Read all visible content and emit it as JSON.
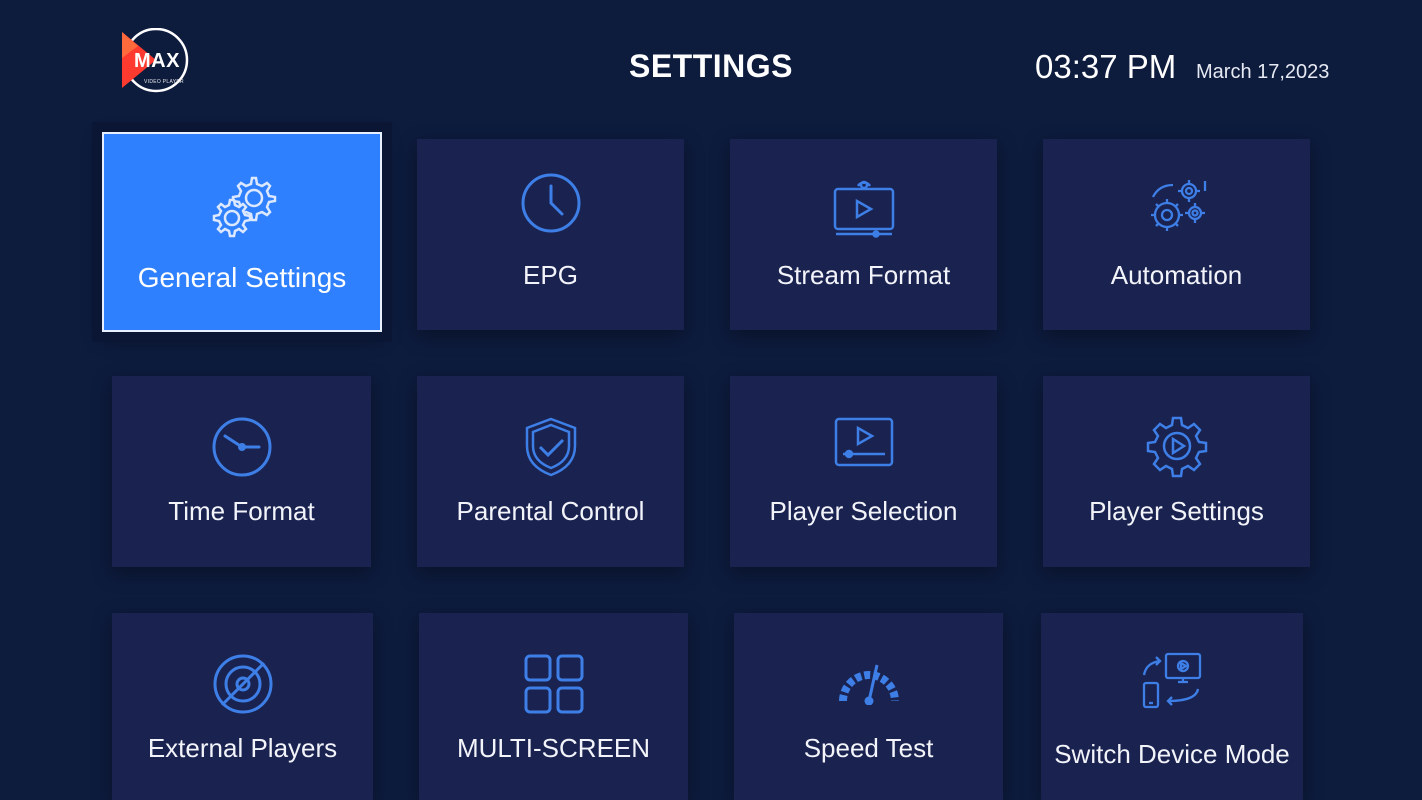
{
  "header": {
    "logo_text": "MAX",
    "logo_subtext": "VIDEO PLAYER",
    "title": "SETTINGS",
    "time": "03:37 PM",
    "date": "March 17,2023"
  },
  "colors": {
    "background": "#0d1b3d",
    "tile": "#1a2250",
    "selected_tile": "#2f80ff",
    "icon": "#3d7fe6",
    "logo_red": "#ff3b2f"
  },
  "tiles": [
    {
      "label": "General Settings",
      "icon": "gears-icon",
      "selected": true
    },
    {
      "label": "EPG",
      "icon": "clock-icon"
    },
    {
      "label": "Stream Format",
      "icon": "stream-screen-icon"
    },
    {
      "label": "Automation",
      "icon": "automation-gears-icon"
    },
    {
      "label": "Time Format",
      "icon": "time-clock-icon"
    },
    {
      "label": "Parental Control",
      "icon": "shield-check-icon"
    },
    {
      "label": "Player Selection",
      "icon": "player-screen-icon"
    },
    {
      "label": "Player Settings",
      "icon": "gear-play-icon"
    },
    {
      "label": "External Players",
      "icon": "disc-slash-icon"
    },
    {
      "label": "MULTI-SCREEN",
      "icon": "grid-icon"
    },
    {
      "label": "Speed Test",
      "icon": "speedometer-icon"
    },
    {
      "label": "Switch Device Mode",
      "icon": "device-switch-icon"
    }
  ]
}
